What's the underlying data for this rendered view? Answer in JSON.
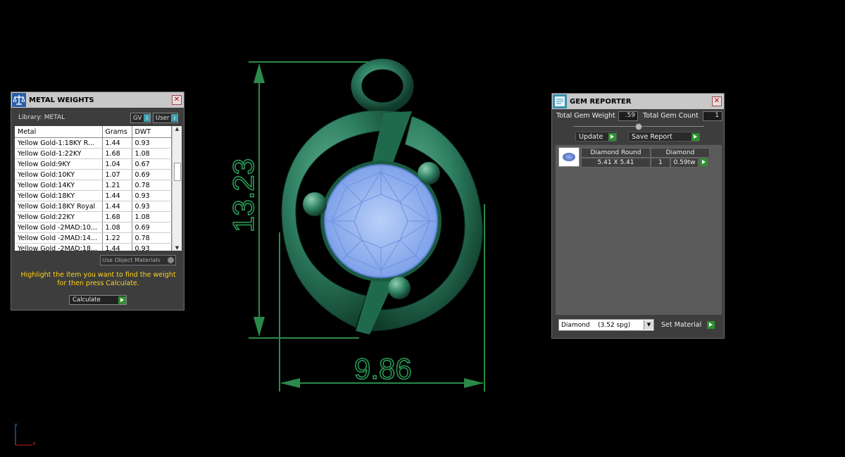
{
  "viewport": {
    "dimension_height": "13.23",
    "dimension_width": "9.86",
    "axis_y": "y",
    "axis_x": "x"
  },
  "metal_weights": {
    "title": "METAL WEIGHTS",
    "library_label": "Library: METAL",
    "gv_label": "GV",
    "user_label": "User",
    "columns": [
      "Metal",
      "Grams",
      "DWT"
    ],
    "rows": [
      {
        "metal": "Yellow Gold-1:18KY R...",
        "grams": "1.44",
        "dwt": "0.93"
      },
      {
        "metal": "Yellow Gold-1:22KY",
        "grams": "1.68",
        "dwt": "1.08"
      },
      {
        "metal": "Yellow Gold:9KY",
        "grams": "1.04",
        "dwt": "0.67"
      },
      {
        "metal": "Yellow Gold:10KY",
        "grams": "1.07",
        "dwt": "0.69"
      },
      {
        "metal": "Yellow Gold:14KY",
        "grams": "1.21",
        "dwt": "0.78"
      },
      {
        "metal": "Yellow Gold:18KY",
        "grams": "1.44",
        "dwt": "0.93"
      },
      {
        "metal": "Yellow Gold:18KY Royal",
        "grams": "1.44",
        "dwt": "0.93"
      },
      {
        "metal": "Yellow Gold:22KY",
        "grams": "1.68",
        "dwt": "1.08"
      },
      {
        "metal": "Yellow Gold -2MAD:10...",
        "grams": "1.08",
        "dwt": "0.69"
      },
      {
        "metal": "Yellow Gold -2MAD:14...",
        "grams": "1.22",
        "dwt": "0.78"
      },
      {
        "metal": "Yellow Gold -2MAD:18...",
        "grams": "1.44",
        "dwt": "0.93"
      }
    ],
    "use_object_materials": "Use Object Materials",
    "instruction": "Highlight the item you want to find the weight for then press Calculate.",
    "calculate_label": "Calculate"
  },
  "gem_reporter": {
    "title": "GEM REPORTER",
    "total_weight_label": "Total Gem Weight",
    "total_weight_value": ".59",
    "total_count_label": "Total Gem Count",
    "total_count_value": "1",
    "update_label": "Update",
    "save_report_label": "Save Report",
    "gem": {
      "name": "Diamond Round",
      "size": "5.41 X 5.41",
      "material": "Diamond",
      "count": "1",
      "weight": "0.59tw"
    },
    "material_select": "Diamond    (3.52 spg)",
    "set_material_label": "Set Material"
  },
  "colors": {
    "metal_green": "#2d7d60",
    "dimension_green": "#2a8a4a",
    "gem_blue": "#8aaef0",
    "instruction_yellow": "#ffd21a"
  }
}
